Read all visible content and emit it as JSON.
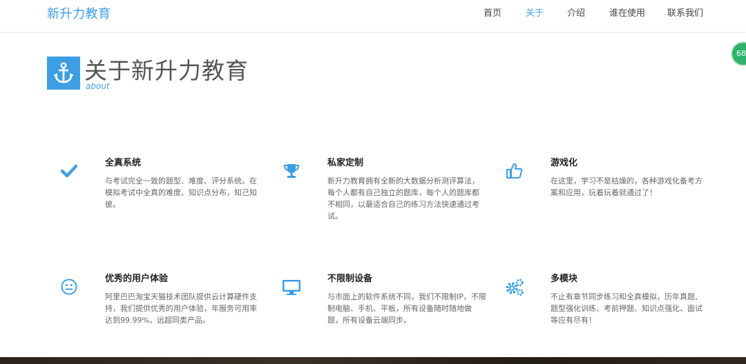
{
  "nav": {
    "brand": "新升力教育",
    "items": [
      {
        "label": "首页"
      },
      {
        "label": "关于"
      },
      {
        "label": "介绍"
      },
      {
        "label": "谁在使用"
      },
      {
        "label": "联系我们"
      }
    ],
    "active_label": "关于"
  },
  "badge": {
    "text": "68"
  },
  "header": {
    "title": "关于新升力教育",
    "subtitle": "about",
    "icon": "anchor-icon"
  },
  "features": [
    {
      "icon": "check-icon",
      "title": "全真系统",
      "desc": "与考试完全一致的题型、难度、评分系统。在模拟考试中全真的难度、知识点分布，知己知彼。"
    },
    {
      "icon": "trophy-icon",
      "title": "私家定制",
      "desc": "新升力教育拥有全新的大数据分析测评算法，每个人都有自己独立的题库，每个人的题库都不相同，以最适合自己的练习方法快速通过考试。"
    },
    {
      "icon": "thumbs-up-icon",
      "title": "游戏化",
      "desc": "在这里，学习不是枯燥的，各种游戏化备考方案和应用，玩着玩着就通过了！"
    },
    {
      "icon": "smile-icon",
      "title": "优秀的用户体验",
      "desc": "阿里巴巴淘宝天猫技术团队提供云计算硬件支持，我们提供优秀的用户体验，年服务可用率达到99.99%，远超同类产品。"
    },
    {
      "icon": "monitor-icon",
      "title": "不限制设备",
      "desc": "与市面上的软件系统不同，我们不限制IP，不限制电脑、手机、平板，所有设备随时随地做题，所有设备云端同步。"
    },
    {
      "icon": "gears-icon",
      "title": "多模块",
      "desc": "不止有章节同步练习和全真模拟，历年真题、题型强化训练、考前押题、知识点强化、面试等应有尽有！"
    }
  ],
  "colors": {
    "accent": "#3e9ee3",
    "text": "#333333",
    "muted": "#666666"
  }
}
